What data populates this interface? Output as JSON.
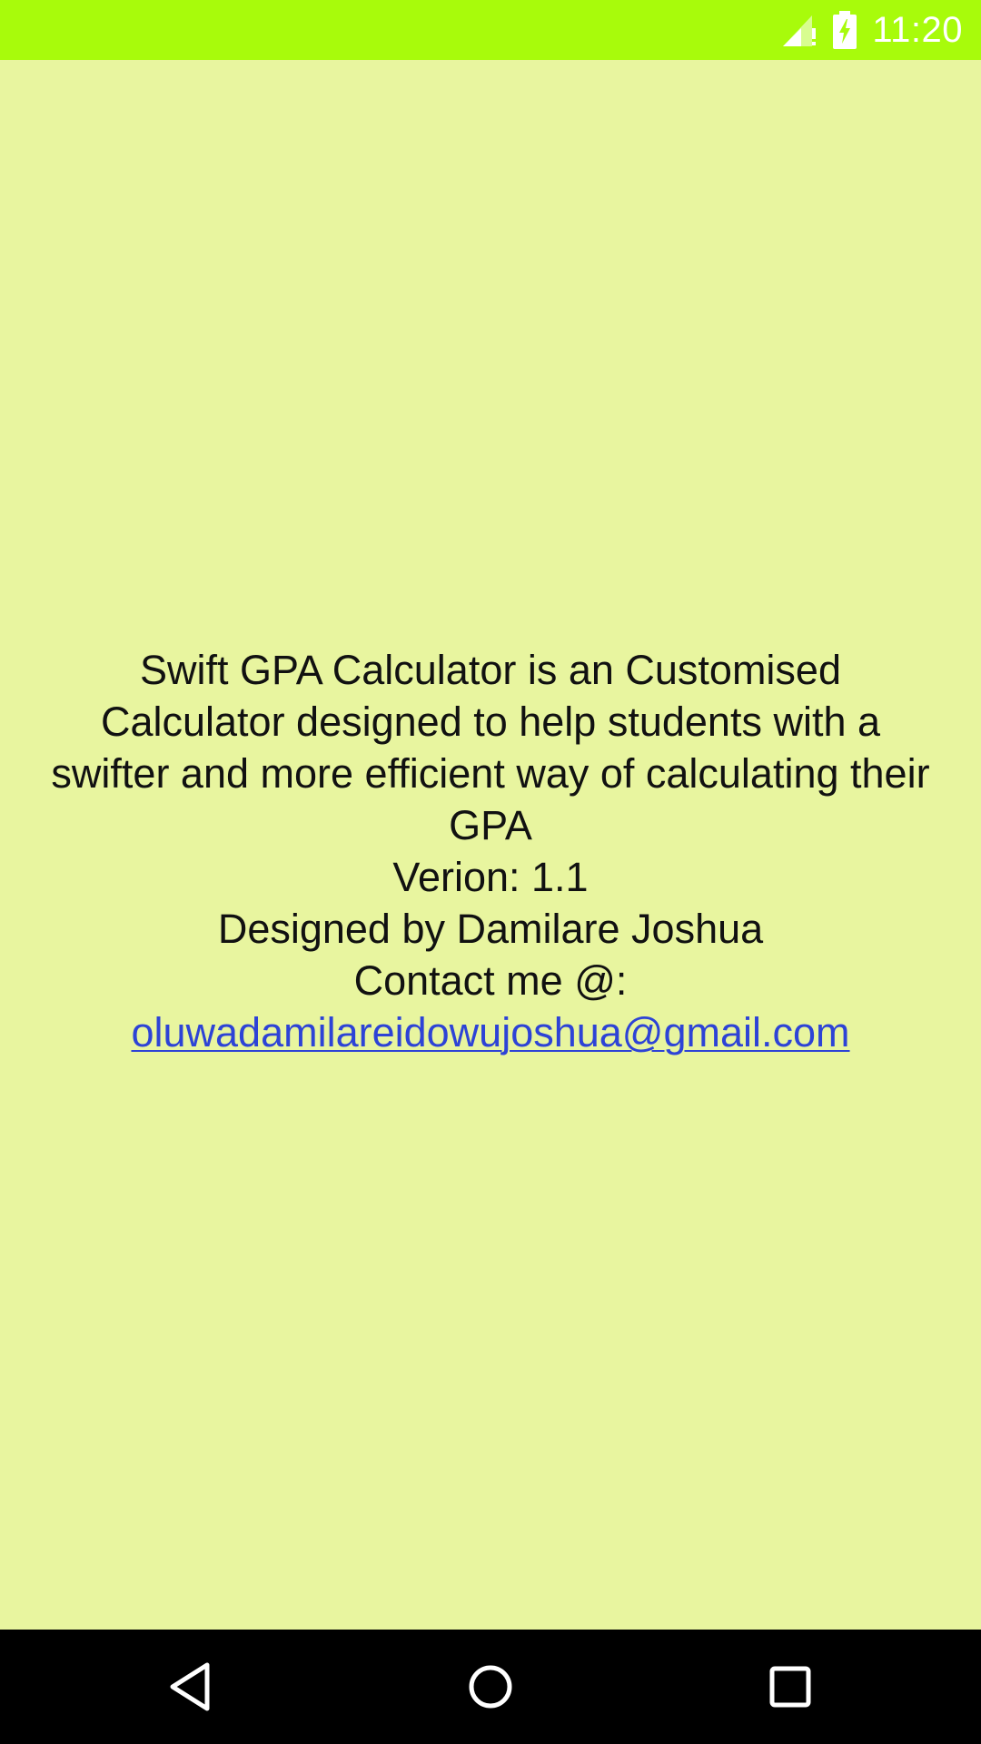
{
  "status_bar": {
    "time": "11:20",
    "bg_color": "#a8fb0b",
    "icons": [
      "signal-icon",
      "battery-charging-icon"
    ]
  },
  "about": {
    "description": "Swift GPA Calculator is an Customised Calculator designed to help students with a swifter and more efficient way of calculating their GPA",
    "version": "Verion: 1.1",
    "designer": "Designed by Damilare Joshua",
    "contact_label": "Contact me @:",
    "email": "oluwadamilareidowujoshua@gmail.com",
    "link_color": "#2d43d6",
    "background_color": "#e8f59f"
  },
  "nav_bar": {
    "buttons": [
      "back-icon",
      "home-icon",
      "recents-icon"
    ]
  }
}
